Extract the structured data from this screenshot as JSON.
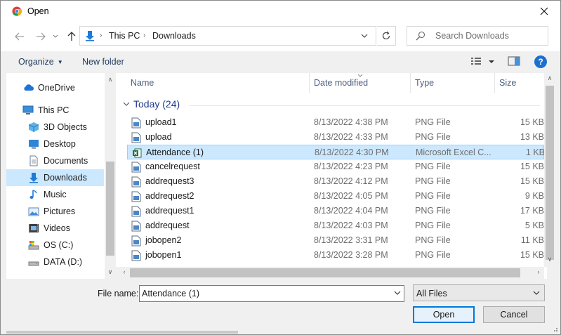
{
  "window": {
    "title": "Open",
    "close_glyph": "✕"
  },
  "address": {
    "crumbs": [
      "This PC",
      "Downloads"
    ],
    "search_placeholder": "Search Downloads"
  },
  "toolbar": {
    "organize": "Organize",
    "new_folder": "New folder",
    "help": "?"
  },
  "nav_pane": {
    "items": [
      {
        "label": "OneDrive",
        "icon": "onedrive-icon"
      },
      {
        "label": "This PC",
        "icon": "computer-icon"
      },
      {
        "label": "3D Objects",
        "icon": "3d-objects-icon"
      },
      {
        "label": "Desktop",
        "icon": "desktop-icon"
      },
      {
        "label": "Documents",
        "icon": "documents-icon"
      },
      {
        "label": "Downloads",
        "icon": "downloads-icon",
        "selected": true
      },
      {
        "label": "Music",
        "icon": "music-icon"
      },
      {
        "label": "Pictures",
        "icon": "pictures-icon"
      },
      {
        "label": "Videos",
        "icon": "videos-icon"
      },
      {
        "label": "OS (C:)",
        "icon": "drive-c-icon"
      },
      {
        "label": "DATA (D:)",
        "icon": "drive-d-icon"
      }
    ]
  },
  "file_list": {
    "columns": {
      "name": "Name",
      "date": "Date modified",
      "type": "Type",
      "size": "Size"
    },
    "group": "Today (24)",
    "rows": [
      {
        "name": "upload1",
        "date": "8/13/2022 4:38 PM",
        "type": "PNG File",
        "size": "15 KB",
        "icon": "png-file-icon"
      },
      {
        "name": "upload",
        "date": "8/13/2022 4:33 PM",
        "type": "PNG File",
        "size": "13 KB",
        "icon": "png-file-icon"
      },
      {
        "name": "Attendance (1)",
        "date": "8/13/2022 4:30 PM",
        "type": "Microsoft Excel C...",
        "size": "1 KB",
        "icon": "excel-file-icon",
        "selected": true
      },
      {
        "name": "cancelrequest",
        "date": "8/13/2022 4:23 PM",
        "type": "PNG File",
        "size": "15 KB",
        "icon": "png-file-icon"
      },
      {
        "name": "addrequest3",
        "date": "8/13/2022 4:12 PM",
        "type": "PNG File",
        "size": "15 KB",
        "icon": "png-file-icon"
      },
      {
        "name": "addrequest2",
        "date": "8/13/2022 4:05 PM",
        "type": "PNG File",
        "size": "9 KB",
        "icon": "png-file-icon"
      },
      {
        "name": "addrequest1",
        "date": "8/13/2022 4:04 PM",
        "type": "PNG File",
        "size": "17 KB",
        "icon": "png-file-icon"
      },
      {
        "name": "addrequest",
        "date": "8/13/2022 4:03 PM",
        "type": "PNG File",
        "size": "5 KB",
        "icon": "png-file-icon"
      },
      {
        "name": "jobopen2",
        "date": "8/13/2022 3:31 PM",
        "type": "PNG File",
        "size": "11 KB",
        "icon": "png-file-icon"
      },
      {
        "name": "jobopen1",
        "date": "8/13/2022 3:28 PM",
        "type": "PNG File",
        "size": "15 KB",
        "icon": "png-file-icon"
      }
    ]
  },
  "bottom": {
    "file_name_label": "File name:",
    "file_name_value": "Attendance (1)",
    "filter": "All Files",
    "open": "Open",
    "cancel": "Cancel"
  },
  "colors": {
    "accent": "#0078d7",
    "selection": "#cce8ff",
    "help": "#1c6fd1"
  }
}
